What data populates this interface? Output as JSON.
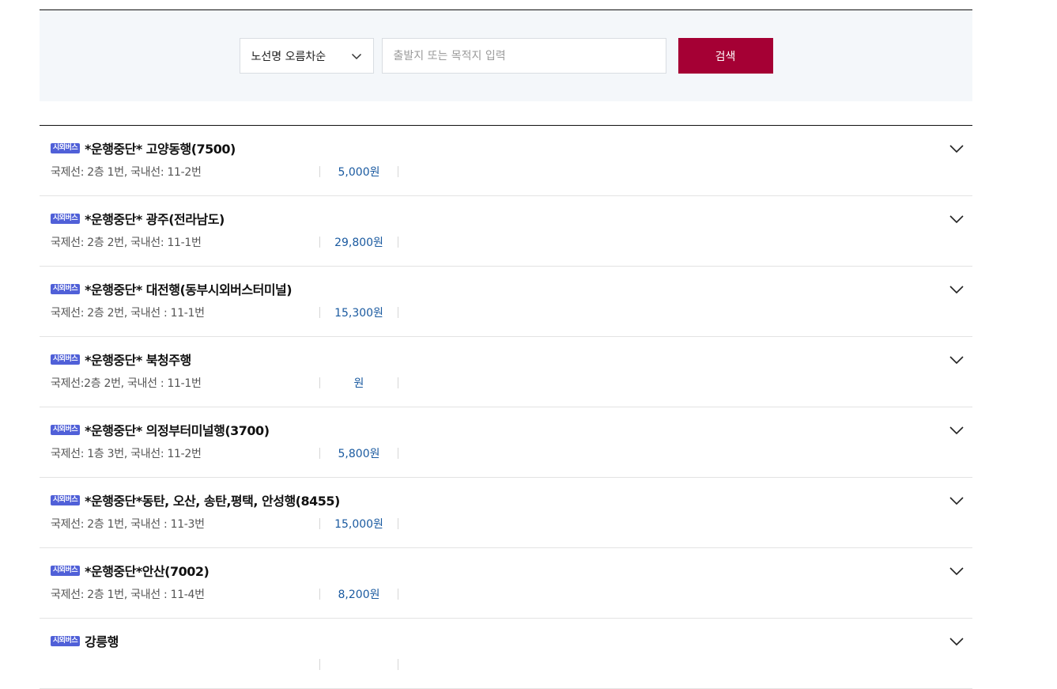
{
  "search": {
    "sort_label": "노선명 오름차순",
    "placeholder": "출발지 또는 목적지 입력",
    "value": "",
    "button_label": "검색"
  },
  "routes": [
    {
      "badge": "시외버스",
      "name": "*운행중단* 고양동행(7500)",
      "platform": "국제선: 2층 1번, 국내선: 11-2번",
      "fare": "5,000원"
    },
    {
      "badge": "시외버스",
      "name": "*운행중단* 광주(전라남도)",
      "platform": "국제선: 2층 2번, 국내선: 11-1번",
      "fare": "29,800원"
    },
    {
      "badge": "시외버스",
      "name": "*운행중단* 대전행(동부시외버스터미널)",
      "platform": "국제선: 2층 2번, 국내선 : 11-1번",
      "fare": "15,300원"
    },
    {
      "badge": "시외버스",
      "name": "*운행중단* 북청주행",
      "platform": "국제선:2층 2번, 국내선 : 11-1번",
      "fare": "원"
    },
    {
      "badge": "시외버스",
      "name": "*운행중단* 의정부터미널행(3700)",
      "platform": "국제선: 1층 3번, 국내선: 11-2번",
      "fare": "5,800원"
    },
    {
      "badge": "시외버스",
      "name": "*운행중단*동탄, 오산, 송탄,평택, 안성행(8455)",
      "platform": "국제선: 2층 1번, 국내선 : 11-3번",
      "fare": "15,000원"
    },
    {
      "badge": "시외버스",
      "name": "*운행중단*안산(7002)",
      "platform": "국제선: 2층 1번, 국내선 : 11-4번",
      "fare": "8,200원"
    },
    {
      "badge": "시외버스",
      "name": "강릉행",
      "platform": "",
      "fare": ""
    }
  ],
  "colors": {
    "accent": "#a50034",
    "badge": "#5060d8",
    "fare": "#1a5aa0",
    "panel_bg": "#f4f7fa"
  },
  "icons": {
    "sort_dropdown": "chevron-down-icon",
    "route_expand": "chevron-down-icon"
  }
}
